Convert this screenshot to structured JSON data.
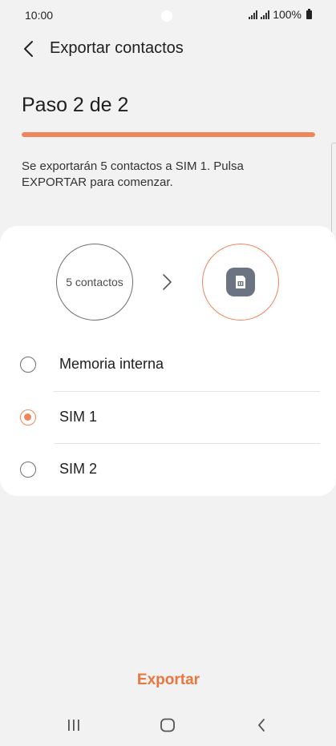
{
  "status_bar": {
    "time": "10:00",
    "battery": "100%"
  },
  "app_bar": {
    "back_icon": "chevron-left-icon",
    "title": "Exportar contactos"
  },
  "step": {
    "label": "Paso 2 de 2",
    "progress": 1.0
  },
  "description": "Se exportarán 5 contactos a SIM 1. Pulsa EXPORTAR para comenzar.",
  "transfer": {
    "source_label": "5 contactos",
    "arrow_icon": "chevron-right-icon",
    "destination_icon": "sim-card-icon"
  },
  "options": [
    {
      "label": "Memoria interna",
      "selected": false
    },
    {
      "label": "SIM 1",
      "selected": true
    },
    {
      "label": "SIM 2",
      "selected": false
    }
  ],
  "actions": {
    "export_label": "Exportar"
  },
  "nav": {
    "recents_icon": "recent-apps-icon",
    "home_icon": "home-icon",
    "back_icon": "back-icon"
  },
  "colors": {
    "accent": "#f0845a",
    "background": "#f2f2f2",
    "card": "#ffffff"
  }
}
